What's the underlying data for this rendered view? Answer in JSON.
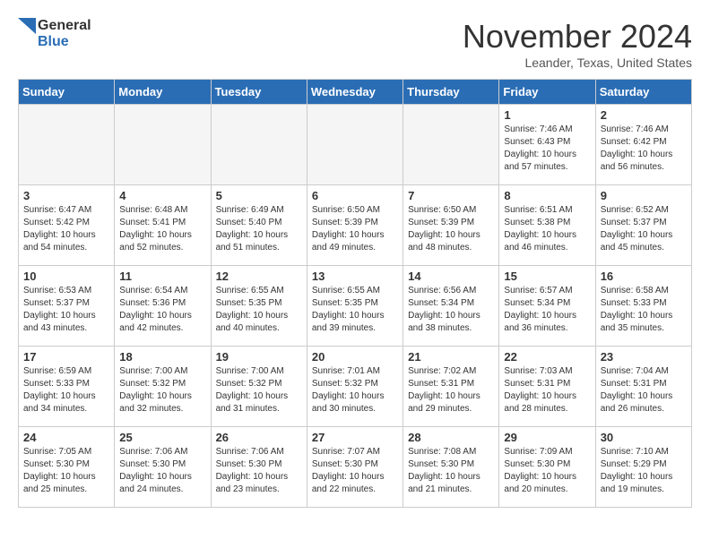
{
  "header": {
    "logo_line1": "General",
    "logo_line2": "Blue",
    "month": "November 2024",
    "location": "Leander, Texas, United States"
  },
  "weekdays": [
    "Sunday",
    "Monday",
    "Tuesday",
    "Wednesday",
    "Thursday",
    "Friday",
    "Saturday"
  ],
  "weeks": [
    [
      {
        "day": "",
        "info": ""
      },
      {
        "day": "",
        "info": ""
      },
      {
        "day": "",
        "info": ""
      },
      {
        "day": "",
        "info": ""
      },
      {
        "day": "",
        "info": ""
      },
      {
        "day": "1",
        "info": "Sunrise: 7:46 AM\nSunset: 6:43 PM\nDaylight: 10 hours\nand 57 minutes."
      },
      {
        "day": "2",
        "info": "Sunrise: 7:46 AM\nSunset: 6:42 PM\nDaylight: 10 hours\nand 56 minutes."
      }
    ],
    [
      {
        "day": "3",
        "info": "Sunrise: 6:47 AM\nSunset: 5:42 PM\nDaylight: 10 hours\nand 54 minutes."
      },
      {
        "day": "4",
        "info": "Sunrise: 6:48 AM\nSunset: 5:41 PM\nDaylight: 10 hours\nand 52 minutes."
      },
      {
        "day": "5",
        "info": "Sunrise: 6:49 AM\nSunset: 5:40 PM\nDaylight: 10 hours\nand 51 minutes."
      },
      {
        "day": "6",
        "info": "Sunrise: 6:50 AM\nSunset: 5:39 PM\nDaylight: 10 hours\nand 49 minutes."
      },
      {
        "day": "7",
        "info": "Sunrise: 6:50 AM\nSunset: 5:39 PM\nDaylight: 10 hours\nand 48 minutes."
      },
      {
        "day": "8",
        "info": "Sunrise: 6:51 AM\nSunset: 5:38 PM\nDaylight: 10 hours\nand 46 minutes."
      },
      {
        "day": "9",
        "info": "Sunrise: 6:52 AM\nSunset: 5:37 PM\nDaylight: 10 hours\nand 45 minutes."
      }
    ],
    [
      {
        "day": "10",
        "info": "Sunrise: 6:53 AM\nSunset: 5:37 PM\nDaylight: 10 hours\nand 43 minutes."
      },
      {
        "day": "11",
        "info": "Sunrise: 6:54 AM\nSunset: 5:36 PM\nDaylight: 10 hours\nand 42 minutes."
      },
      {
        "day": "12",
        "info": "Sunrise: 6:55 AM\nSunset: 5:35 PM\nDaylight: 10 hours\nand 40 minutes."
      },
      {
        "day": "13",
        "info": "Sunrise: 6:55 AM\nSunset: 5:35 PM\nDaylight: 10 hours\nand 39 minutes."
      },
      {
        "day": "14",
        "info": "Sunrise: 6:56 AM\nSunset: 5:34 PM\nDaylight: 10 hours\nand 38 minutes."
      },
      {
        "day": "15",
        "info": "Sunrise: 6:57 AM\nSunset: 5:34 PM\nDaylight: 10 hours\nand 36 minutes."
      },
      {
        "day": "16",
        "info": "Sunrise: 6:58 AM\nSunset: 5:33 PM\nDaylight: 10 hours\nand 35 minutes."
      }
    ],
    [
      {
        "day": "17",
        "info": "Sunrise: 6:59 AM\nSunset: 5:33 PM\nDaylight: 10 hours\nand 34 minutes."
      },
      {
        "day": "18",
        "info": "Sunrise: 7:00 AM\nSunset: 5:32 PM\nDaylight: 10 hours\nand 32 minutes."
      },
      {
        "day": "19",
        "info": "Sunrise: 7:00 AM\nSunset: 5:32 PM\nDaylight: 10 hours\nand 31 minutes."
      },
      {
        "day": "20",
        "info": "Sunrise: 7:01 AM\nSunset: 5:32 PM\nDaylight: 10 hours\nand 30 minutes."
      },
      {
        "day": "21",
        "info": "Sunrise: 7:02 AM\nSunset: 5:31 PM\nDaylight: 10 hours\nand 29 minutes."
      },
      {
        "day": "22",
        "info": "Sunrise: 7:03 AM\nSunset: 5:31 PM\nDaylight: 10 hours\nand 28 minutes."
      },
      {
        "day": "23",
        "info": "Sunrise: 7:04 AM\nSunset: 5:31 PM\nDaylight: 10 hours\nand 26 minutes."
      }
    ],
    [
      {
        "day": "24",
        "info": "Sunrise: 7:05 AM\nSunset: 5:30 PM\nDaylight: 10 hours\nand 25 minutes."
      },
      {
        "day": "25",
        "info": "Sunrise: 7:06 AM\nSunset: 5:30 PM\nDaylight: 10 hours\nand 24 minutes."
      },
      {
        "day": "26",
        "info": "Sunrise: 7:06 AM\nSunset: 5:30 PM\nDaylight: 10 hours\nand 23 minutes."
      },
      {
        "day": "27",
        "info": "Sunrise: 7:07 AM\nSunset: 5:30 PM\nDaylight: 10 hours\nand 22 minutes."
      },
      {
        "day": "28",
        "info": "Sunrise: 7:08 AM\nSunset: 5:30 PM\nDaylight: 10 hours\nand 21 minutes."
      },
      {
        "day": "29",
        "info": "Sunrise: 7:09 AM\nSunset: 5:30 PM\nDaylight: 10 hours\nand 20 minutes."
      },
      {
        "day": "30",
        "info": "Sunrise: 7:10 AM\nSunset: 5:29 PM\nDaylight: 10 hours\nand 19 minutes."
      }
    ]
  ]
}
